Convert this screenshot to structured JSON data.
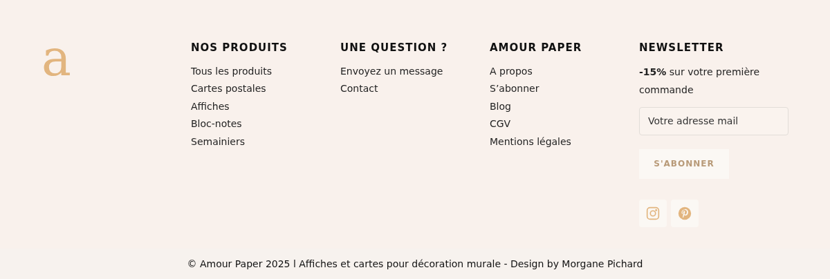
{
  "logo": {
    "letter": "a"
  },
  "columns": [
    {
      "title": "NOS PRODUITS",
      "links": [
        "Tous les produits",
        "Cartes postales",
        "Affiches",
        "Bloc-notes",
        "Semainiers"
      ]
    },
    {
      "title": "UNE QUESTION ?",
      "links": [
        "Envoyez un message",
        "Contact"
      ]
    },
    {
      "title": "AMOUR PAPER",
      "links": [
        "A propos",
        "S’abonner",
        "Blog",
        "CGV",
        "Mentions légales"
      ]
    }
  ],
  "newsletter": {
    "title": "NEWSLETTER",
    "text": "**-15%** sur votre première commande",
    "email": {
      "placeholder": "Votre adresse mail"
    },
    "button": "S'ABONNER",
    "socials": [
      {
        "kind": "instagram"
      },
      {
        "kind": "pinterest"
      }
    ]
  },
  "copyright": "© Amour Paper 2025 l Affiches et cartes pour décoration murale - Design by Morgane Pichard"
}
